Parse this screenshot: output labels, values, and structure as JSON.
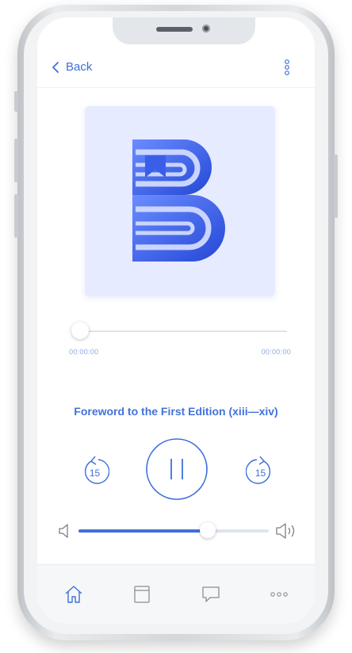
{
  "header": {
    "back_label": "Back"
  },
  "player": {
    "current_time": "00:00:00",
    "total_time": "00:00:00",
    "progress": 0,
    "chapter_title": "Foreword to the First Edition (xiii—xiv)",
    "rewind_seconds": "15",
    "forward_seconds": "15",
    "state": "playing",
    "volume": 0.68
  },
  "tabbar": {
    "items": [
      {
        "icon": "home-icon",
        "active": true
      },
      {
        "icon": "book-icon",
        "active": false
      },
      {
        "icon": "chat-icon",
        "active": false
      },
      {
        "icon": "more-horizontal-icon",
        "active": false
      }
    ]
  },
  "colors": {
    "accent": "#3f6fdc",
    "cover_bg": "#e6ebff"
  }
}
